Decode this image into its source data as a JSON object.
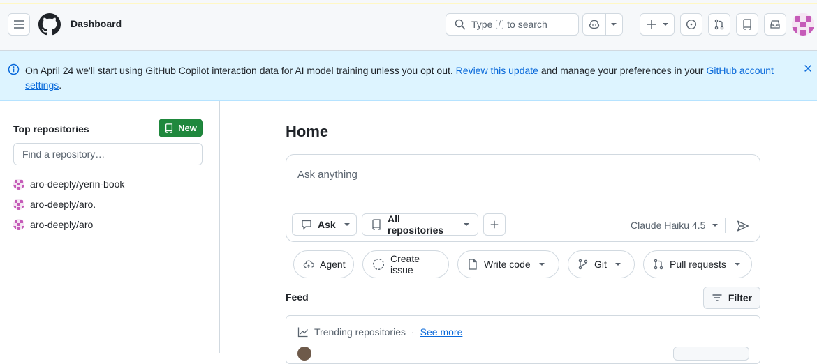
{
  "header": {
    "title": "Dashboard",
    "search": {
      "pre": "Type",
      "key": "/",
      "post": "to search"
    }
  },
  "banner": {
    "text_before": "On April 24 we'll start using GitHub Copilot interaction data for AI model training unless you opt out.",
    "link1": "Review this update",
    "text_middle": "and manage your preferences in your",
    "link2": "GitHub account settings",
    "text_after": "."
  },
  "sidebar": {
    "title": "Top repositories",
    "new_label": "New",
    "find_placeholder": "Find a repository…",
    "repos": [
      "aro-deeply/yerin-book",
      "aro-deeply/aro.",
      "aro-deeply/aro"
    ]
  },
  "main": {
    "title": "Home",
    "ask": {
      "placeholder": "Ask anything",
      "mode_label": "Ask",
      "repos_label": "All repositories",
      "model_label": "Claude Haiku 4.5"
    },
    "chips": [
      "Agent",
      "Create issue",
      "Write code",
      "Git",
      "Pull requests"
    ],
    "feed_title": "Feed",
    "filter_label": "Filter",
    "trending": {
      "label": "Trending repositories",
      "sep": "·",
      "see_more": "See more"
    }
  },
  "colors": {
    "accent_green": "#1f883d",
    "link_blue": "#0969da",
    "banner_bg": "#ddf4ff"
  },
  "icons": [
    "hamburger-icon",
    "github-logo-icon",
    "search-icon",
    "copilot-icon",
    "plus-icon",
    "issue-icon",
    "pull-request-icon",
    "repo-icon",
    "inbox-icon",
    "info-icon",
    "close-icon",
    "comment-icon",
    "send-icon",
    "cloud-icon",
    "dashed-circle-icon",
    "file-icon",
    "git-branch-icon",
    "graph-icon",
    "filter-icon"
  ]
}
